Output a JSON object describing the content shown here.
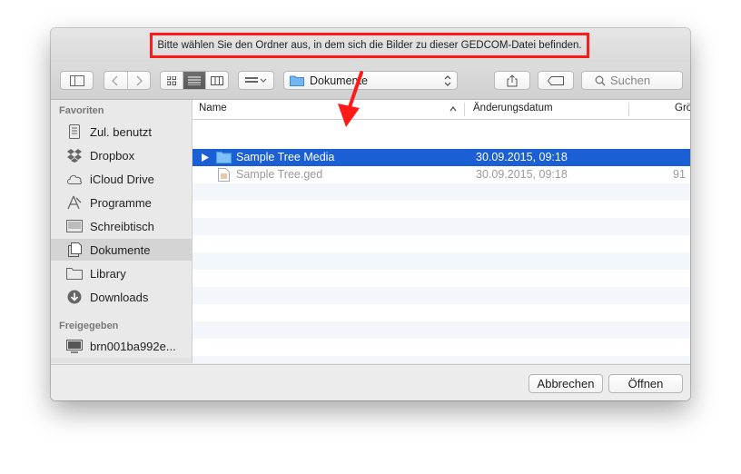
{
  "dialog": {
    "prompt": "Bitte wählen Sie den Ordner aus, in dem sich die Bilder zu dieser GEDCOM-Datei befinden."
  },
  "toolbar": {
    "location": "Dokumente",
    "search_placeholder": "Suchen"
  },
  "sidebar": {
    "favorites_heading": "Favoriten",
    "favorites": [
      {
        "label": "Zul. benutzt",
        "icon": "recents-icon"
      },
      {
        "label": "Dropbox",
        "icon": "dropbox-icon"
      },
      {
        "label": "iCloud Drive",
        "icon": "cloud-icon"
      },
      {
        "label": "Programme",
        "icon": "applications-icon"
      },
      {
        "label": "Schreibtisch",
        "icon": "desktop-icon"
      },
      {
        "label": "Dokumente",
        "icon": "documents-icon"
      },
      {
        "label": "Library",
        "icon": "folder-icon"
      },
      {
        "label": "Downloads",
        "icon": "downloads-icon"
      }
    ],
    "shared_heading": "Freigegeben",
    "shared": [
      {
        "label": "brn001ba992e...",
        "icon": "computer-icon"
      }
    ],
    "selected": "Dokumente"
  },
  "columns": {
    "name": "Name",
    "date": "Änderungsdatum",
    "size": "Grö"
  },
  "files": [
    {
      "name": "Sample Tree Media",
      "date": "30.09.2015, 09:18",
      "size": "",
      "kind": "folder",
      "selected": true
    },
    {
      "name": "Sample Tree.ged",
      "date": "30.09.2015, 09:18",
      "size": "91",
      "kind": "file",
      "selected": false
    }
  ],
  "buttons": {
    "cancel": "Abbrechen",
    "open": "Öffnen"
  },
  "colors": {
    "selection": "#1a5fd3",
    "annotation": "#ff1a1a"
  }
}
